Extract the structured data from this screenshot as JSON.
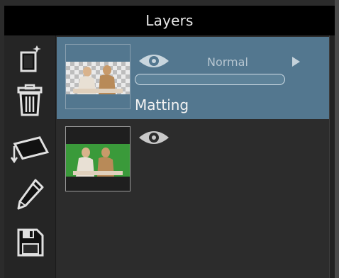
{
  "panel": {
    "title": "Layers"
  },
  "toolbar": {
    "tools": [
      {
        "icon": "new-layer-icon"
      },
      {
        "icon": "trash-icon"
      },
      {
        "icon": "tablet-import-icon"
      },
      {
        "icon": "pencil-icon"
      },
      {
        "icon": "save-icon"
      }
    ]
  },
  "layers": [
    {
      "name": "Matting",
      "blend_mode": "Normal",
      "visible": true,
      "selected": true,
      "thumbnail": "checkerboard-with-people",
      "opacity": 1.0
    },
    {
      "name": "",
      "visible": true,
      "selected": false,
      "thumbnail": "green-screen-with-people"
    }
  ],
  "colors": {
    "title_bg": "#000000",
    "selected_row": "#53778f",
    "panel_bg": "#2c2c2c"
  }
}
